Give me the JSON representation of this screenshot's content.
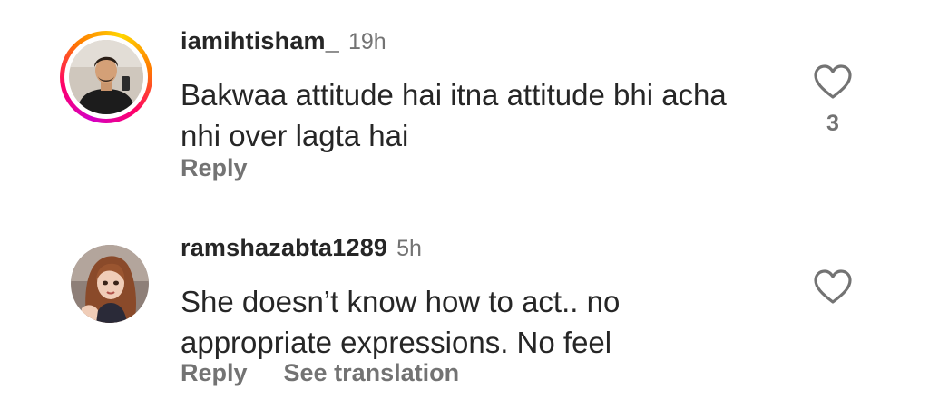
{
  "comments": [
    {
      "username": "iamihtisham_",
      "time": "19h",
      "text": "Bakwaa attitude hai itna attitude bhi acha nhi over lagta hai",
      "reply_label": "Reply",
      "like_count": "3",
      "has_story_ring": true
    },
    {
      "username": "ramshazabta1289",
      "time": "5h",
      "text": "She doesn’t know how to act.. no appropriate expressions. No feel",
      "reply_label": "Reply",
      "translate_label": "See translation",
      "has_story_ring": false
    }
  ],
  "colors": {
    "text_primary": "#262626",
    "text_secondary": "#737373",
    "story_ring": [
      "#d300c5",
      "#ff0069",
      "#ff7a00",
      "#ffd600"
    ]
  },
  "icons": {
    "like": "heart-outline-icon"
  }
}
